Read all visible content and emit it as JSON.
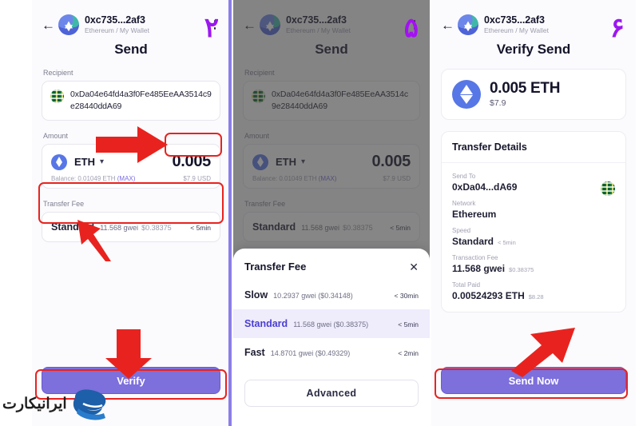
{
  "meta": {
    "watermark_text": "ایرانیکارت",
    "accent_purple": "#7d6fdc",
    "annotation_red": "#e8231f",
    "divider_purple": "#8b7ee8"
  },
  "panel1": {
    "step_number": "۲",
    "header": {
      "back_icon": "back-arrow-icon",
      "address": "0xc735...2af3",
      "subtitle": "Ethereum / My Wallet",
      "menu_icon": "kebab-menu-icon"
    },
    "title": "Send",
    "recipient": {
      "label": "Recipient",
      "address": "0xDa04e64fd4a3f0Fe485EeAA3514c9e28440ddA69"
    },
    "amount": {
      "label": "Amount",
      "token": "ETH",
      "value": "0.005",
      "balance": "Balance: 0.01049 ETH",
      "max": "(MAX)",
      "usd": "$7.9 USD"
    },
    "fee": {
      "label": "Transfer Fee",
      "name": "Standard",
      "gwei": "11.568 gwei",
      "usd": "$0.38375",
      "time": "< 5min"
    },
    "cta": "Verify"
  },
  "panel2": {
    "step_number": "۵",
    "header": {
      "address": "0xc735...2af3",
      "subtitle": "Ethereum / My Wallet"
    },
    "title": "Send",
    "recipient": {
      "label": "Recipient",
      "address": "0xDa04e64fd4a3f0Fe485EeAA3514c9e28440ddA69"
    },
    "amount": {
      "label": "Amount",
      "token": "ETH",
      "value": "0.005",
      "balance": "Balance: 0.01049 ETH",
      "max": "(MAX)",
      "usd": "$7.9 USD"
    },
    "fee": {
      "label": "Transfer Fee",
      "name": "Standard",
      "gwei": "11.568 gwei",
      "usd": "$0.38375",
      "time": "< 5min"
    },
    "sheet": {
      "title": "Transfer Fee",
      "close_icon": "close-icon",
      "options": [
        {
          "name": "Slow",
          "detail": "10.2937 gwei ($0.34148)",
          "time": "< 30min",
          "selected": false
        },
        {
          "name": "Standard",
          "detail": "11.568 gwei ($0.38375)",
          "time": "< 5min",
          "selected": true
        },
        {
          "name": "Fast",
          "detail": "14.8701 gwei ($0.49329)",
          "time": "< 2min",
          "selected": false
        }
      ],
      "advanced_label": "Advanced"
    }
  },
  "panel3": {
    "step_number": "۶",
    "header": {
      "address": "0xc735...2af3",
      "subtitle": "Ethereum / My Wallet"
    },
    "title": "Verify Send",
    "summary": {
      "amount": "0.005 ETH",
      "usd": "$7.9"
    },
    "details": {
      "header": "Transfer Details",
      "rows": [
        {
          "label": "Send To",
          "value": "0xDa04...dA69",
          "mini": "",
          "has_blockie": true
        },
        {
          "label": "Network",
          "value": "Ethereum",
          "mini": "",
          "has_blockie": false
        },
        {
          "label": "Speed",
          "value": "Standard",
          "mini": "< 5min",
          "has_blockie": false
        },
        {
          "label": "Transaction Fee",
          "value": "11.568 gwei",
          "mini": "$0.38375",
          "has_blockie": false
        },
        {
          "label": "Total Paid",
          "value": "0.00524293 ETH",
          "mini": "$8.28",
          "has_blockie": false
        }
      ]
    },
    "cta": "Send Now"
  }
}
